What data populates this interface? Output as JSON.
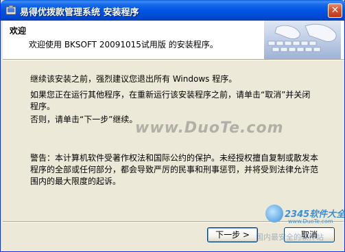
{
  "window": {
    "title": "易得优拨款管理系统 安装程序"
  },
  "header": {
    "title": "欢迎",
    "subtitle": "欢迎使用 BKSOFT 20091015试用版 的安装程序。"
  },
  "body": {
    "p1": "继续该安装之前，强烈建议您退出所有 Windows 程序。",
    "p2": "如果您正在运行其他程序，在重新运行该安装程序之前，请单击“取消”并关闭程序。",
    "p3": "否则，请单击“下一步”继续。",
    "p4": "警告：本计算机软件受著作权法和国际公约的保护。未经授权擅自复制或散发本程序的全部或任何部分，都会导致严厉的民事和刑事惩罚，并将受到法律允许范围内的最大限度的起诉。"
  },
  "watermark": {
    "text": "www.DuoTe.com",
    "logo_text": "2345软件大全",
    "logo_url": "www.DuoTe.com",
    "bottom_text": "国内最安全的软件站"
  },
  "buttons": {
    "next": "下一步 >",
    "cancel": "取消"
  },
  "icons": {
    "title": "installer-icon",
    "close": "close-icon",
    "header": "keyboard-hands-image"
  },
  "colors": {
    "titlebar": "#0055e5",
    "close": "#d8522e",
    "face": "#ece9d8"
  }
}
